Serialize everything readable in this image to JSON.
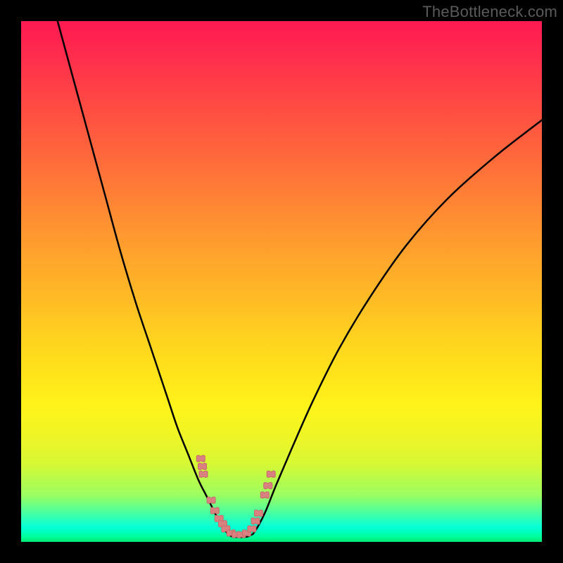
{
  "watermark": "TheBottleneck.com",
  "colors": {
    "frame": "#000000",
    "curve": "#000000",
    "marker_fill": "#d98080",
    "marker_stroke": "#c86a6a"
  },
  "chart_data": {
    "type": "line",
    "title": "",
    "xlabel": "",
    "ylabel": "",
    "xlim": [
      0,
      100
    ],
    "ylim": [
      0,
      100
    ],
    "grid": false,
    "legend": false,
    "series": [
      {
        "name": "left-curve",
        "x": [
          7,
          10,
          13,
          16,
          19,
          22,
          25,
          28,
          30,
          32,
          34,
          35.5,
          37,
          38,
          39,
          39.7
        ],
        "y": [
          100,
          89,
          78,
          67,
          56,
          46,
          37,
          28,
          22,
          17,
          12,
          9,
          6,
          4,
          2.5,
          1.5
        ]
      },
      {
        "name": "right-curve",
        "x": [
          44.5,
          45.5,
          47,
          49,
          52,
          56,
          61,
          67,
          74,
          82,
          91,
          100
        ],
        "y": [
          1.5,
          3,
          6,
          11,
          18,
          27,
          37,
          47,
          57,
          66,
          74,
          81
        ]
      },
      {
        "name": "valley-floor",
        "x": [
          39.7,
          40.5,
          41.5,
          42.5,
          43.5,
          44.5
        ],
        "y": [
          1.5,
          1.0,
          0.9,
          0.9,
          1.0,
          1.5
        ]
      }
    ],
    "markers": [
      {
        "cluster": "left-upper",
        "cx": 34.5,
        "cy": 16.0
      },
      {
        "cluster": "left-upper",
        "cx": 34.8,
        "cy": 14.5
      },
      {
        "cluster": "left-upper",
        "cx": 35.0,
        "cy": 13.0
      },
      {
        "cluster": "left-lower",
        "cx": 36.5,
        "cy": 8.0
      },
      {
        "cluster": "left-lower",
        "cx": 37.2,
        "cy": 6.0
      },
      {
        "cluster": "left-lower",
        "cx": 38.0,
        "cy": 4.5
      },
      {
        "cluster": "left-lower",
        "cx": 38.7,
        "cy": 3.5
      },
      {
        "cluster": "left-lower",
        "cx": 39.3,
        "cy": 2.5
      },
      {
        "cluster": "floor",
        "cx": 40.3,
        "cy": 1.7
      },
      {
        "cluster": "floor",
        "cx": 41.3,
        "cy": 1.4
      },
      {
        "cluster": "floor",
        "cx": 42.3,
        "cy": 1.4
      },
      {
        "cluster": "floor",
        "cx": 43.3,
        "cy": 1.7
      },
      {
        "cluster": "right-lower",
        "cx": 44.3,
        "cy": 2.5
      },
      {
        "cluster": "right-lower",
        "cx": 45.0,
        "cy": 4.0
      },
      {
        "cluster": "right-lower",
        "cx": 45.6,
        "cy": 5.5
      },
      {
        "cluster": "right-upper",
        "cx": 46.8,
        "cy": 9.0
      },
      {
        "cluster": "right-upper",
        "cx": 47.4,
        "cy": 10.8
      },
      {
        "cluster": "right-upper",
        "cx": 48.0,
        "cy": 13.0
      }
    ],
    "annotations": [],
    "background": "thermal-gradient"
  }
}
